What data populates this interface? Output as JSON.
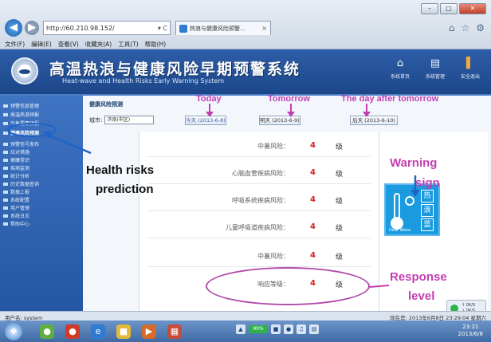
{
  "browser": {
    "address": "http://60.210.98.152/",
    "address_controls": "▾ C",
    "tab_label": "热浪与健康风险预警...",
    "tab_close": "×",
    "menu": [
      "文件(F)",
      "编辑(E)",
      "查看(V)",
      "收藏夹(A)",
      "工具(T)",
      "帮助(H)"
    ],
    "window_buttons": [
      "–",
      "□",
      "✕"
    ]
  },
  "banner": {
    "title_cn": "高温热浪与健康风险早期预警系统",
    "title_en": "Heat-wave and Health Risks Early Warning System",
    "nav": [
      {
        "label": "系统首页",
        "icon": "house-icon"
      },
      {
        "label": "系统管理",
        "icon": "document-icon"
      },
      {
        "label": "安全退出",
        "icon": "door-exit-icon"
      }
    ]
  },
  "sidebar": {
    "items": [
      {
        "label": "预警信息管理"
      },
      {
        "label": "高温热浪预报"
      },
      {
        "label": "气象要素预报"
      },
      {
        "label": "健康风险预测",
        "active": true
      },
      {
        "label": "预警信号发布"
      },
      {
        "label": "应对措施"
      },
      {
        "label": "健康常识"
      },
      {
        "label": "疾病监测"
      },
      {
        "label": "统计分析"
      },
      {
        "label": "历史数据查询"
      },
      {
        "label": "数据上报"
      },
      {
        "label": "系统配置"
      },
      {
        "label": "用户管理"
      },
      {
        "label": "系统日志"
      },
      {
        "label": "帮助中心"
      }
    ]
  },
  "content": {
    "heading": "健康风险预测",
    "city_label": "城市:",
    "city_value": "济南(市区)",
    "dates": {
      "today": "今天 (2013-6-8)",
      "tomorrow": "明天 (2013-6-9)",
      "after": "后天 (2013-6-10)"
    },
    "risk_rows": [
      {
        "label": "中暑风险：",
        "level": "4",
        "unit": "级"
      },
      {
        "label": "心脑血管疾病风险：",
        "level": "4",
        "unit": "级"
      },
      {
        "label": "呼吸系统疾病风险：",
        "level": "4",
        "unit": "级"
      },
      {
        "label": "儿童呼吸道疾病风险：",
        "level": "4",
        "unit": "级"
      },
      {
        "label": "中暑风险：",
        "level": "4",
        "unit": "级"
      },
      {
        "label": "响应等级：",
        "level": "4",
        "unit": "级"
      }
    ],
    "warning_sign": {
      "chars": [
        "热",
        "浪",
        "蓝"
      ],
      "caption": "Heat Wave"
    }
  },
  "annotations": {
    "today": "Today",
    "tomorrow": "Tomorrow",
    "after": "The day after tomorrow",
    "health_risks": "Health risks",
    "prediction": "prediction",
    "warning": "Warning",
    "sign": "sign",
    "response": "Response",
    "level": "level"
  },
  "status": {
    "left": "用户名: system",
    "right": "现在是: 2013年6月8日 23:29:04 星期六"
  },
  "taskbar": {
    "battery": "99%",
    "clock_time": "23:21",
    "clock_date": "2013/6/8"
  },
  "network_widget": {
    "up": "↑ 0K/S",
    "down": "↓ 0K/S"
  },
  "colors": {
    "banner": "#1c4689",
    "sidebar": "#2556a4",
    "annotation_purple": "#c23fb2",
    "risk_level": "#d82020",
    "warning_sign": "#1a9be0"
  }
}
